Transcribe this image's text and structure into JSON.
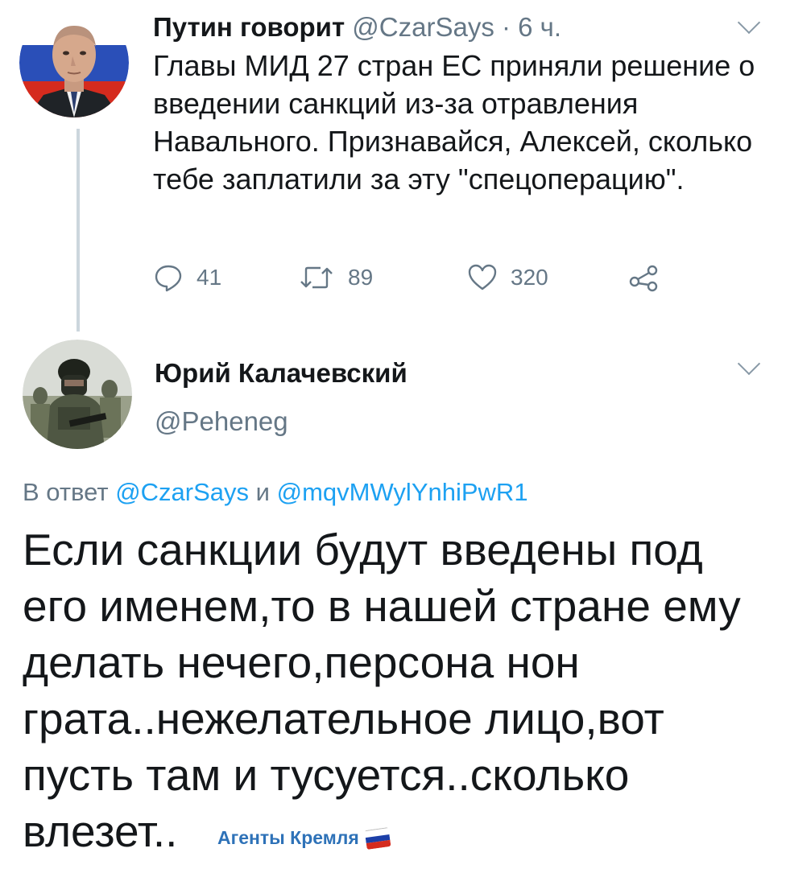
{
  "tweet1": {
    "author_name": "Путин говорит",
    "handle": "@CzarSays",
    "separator": " · ",
    "time": "6 ч.",
    "text": "Главы МИД 27 стран ЕС приняли решение о введении санкций из-за отравления Навального. Признавайся, Алексей, сколько тебе заплатили за эту \"спецоперацию\".",
    "replies": "41",
    "retweets": "89",
    "likes": "320",
    "icons": [
      "reply-icon",
      "retweet-icon",
      "like-icon",
      "share-icon",
      "chevron-down-icon"
    ]
  },
  "tweet2": {
    "author_name": "Юрий Калачевский",
    "handle": "@Peheneg",
    "reply_prefix": "В ответ ",
    "reply_mention1": "@CzarSays",
    "reply_and": " и ",
    "reply_mention2": "@mqvMWylYnhiPwR1",
    "text": "Если санкции будут введены под его именем,то в нашей стране ему делать нечего,персона нон грата..нежелательное лицо,вот пусть там и тусуется..сколько влезет.."
  },
  "watermark": {
    "text": "Агенты Кремля",
    "flag_colors": [
      "#ffffff",
      "#1c3fa8",
      "#d52b1e"
    ]
  },
  "colors": {
    "text_primary": "#14171a",
    "text_secondary": "#657786",
    "link": "#1da1f2",
    "thread_line": "#ccd6dd"
  }
}
